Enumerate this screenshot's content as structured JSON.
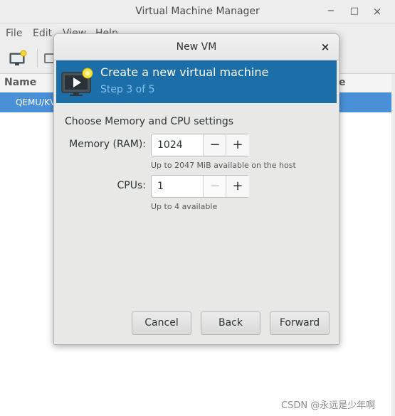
{
  "main_window": {
    "title": "Virtual Machine Manager",
    "controls": {
      "minimize": "−",
      "maximize": "□",
      "close": "×"
    },
    "menu": [
      "File",
      "Edit",
      "View",
      "Help"
    ],
    "list_header": {
      "name": "Name",
      "usage": "ge"
    },
    "selected_row": "QEMU/KV"
  },
  "dialog": {
    "title": "New VM",
    "close": "×",
    "banner": {
      "title": "Create a new virtual machine",
      "step": "Step 3 of 5",
      "icon": "monitor-play-star-icon"
    },
    "section_title": "Choose Memory and CPU settings",
    "memory": {
      "label": "Memory (RAM):",
      "value": "1024",
      "minus": "−",
      "plus": "+",
      "hint": "Up to 2047 MiB available on the host"
    },
    "cpus": {
      "label": "CPUs:",
      "value": "1",
      "minus": "−",
      "plus": "+",
      "hint": "Up to 4 available"
    },
    "buttons": {
      "cancel": "Cancel",
      "back": "Back",
      "forward": "Forward"
    }
  },
  "watermark": "CSDN @永远是少年啊",
  "colors": {
    "banner": "#1b6ea8",
    "banner_subtitle": "#86c2ee",
    "selection": "#4a90d9",
    "dialog_bg": "#e8e8e7"
  }
}
